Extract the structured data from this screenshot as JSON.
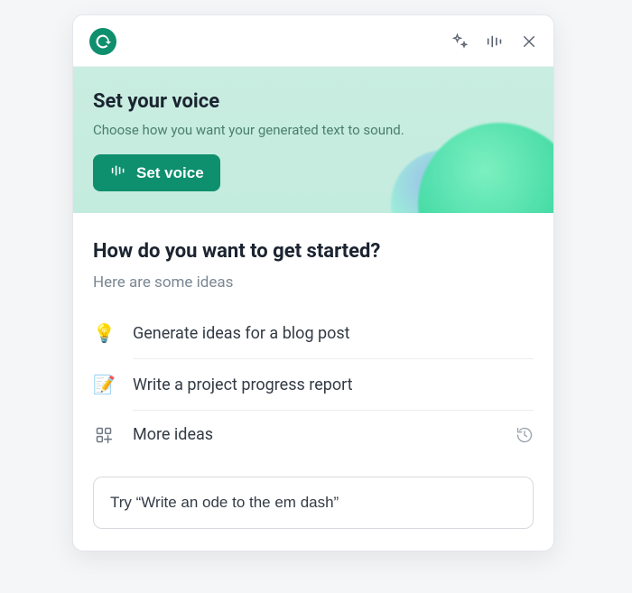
{
  "voice": {
    "title": "Set your voice",
    "subtitle": "Choose how you want your generated text to sound.",
    "button": "Set voice"
  },
  "main": {
    "title": "How do you want to get started?",
    "subtitle": "Here are some ideas"
  },
  "ideas": [
    {
      "emoji": "💡",
      "label": "Generate ideas for a blog post"
    },
    {
      "emoji": "📝",
      "label": "Write a project progress report"
    }
  ],
  "more": {
    "label": "More ideas"
  },
  "prompt": {
    "placeholder": "Try “Write an ode to the em dash”"
  }
}
